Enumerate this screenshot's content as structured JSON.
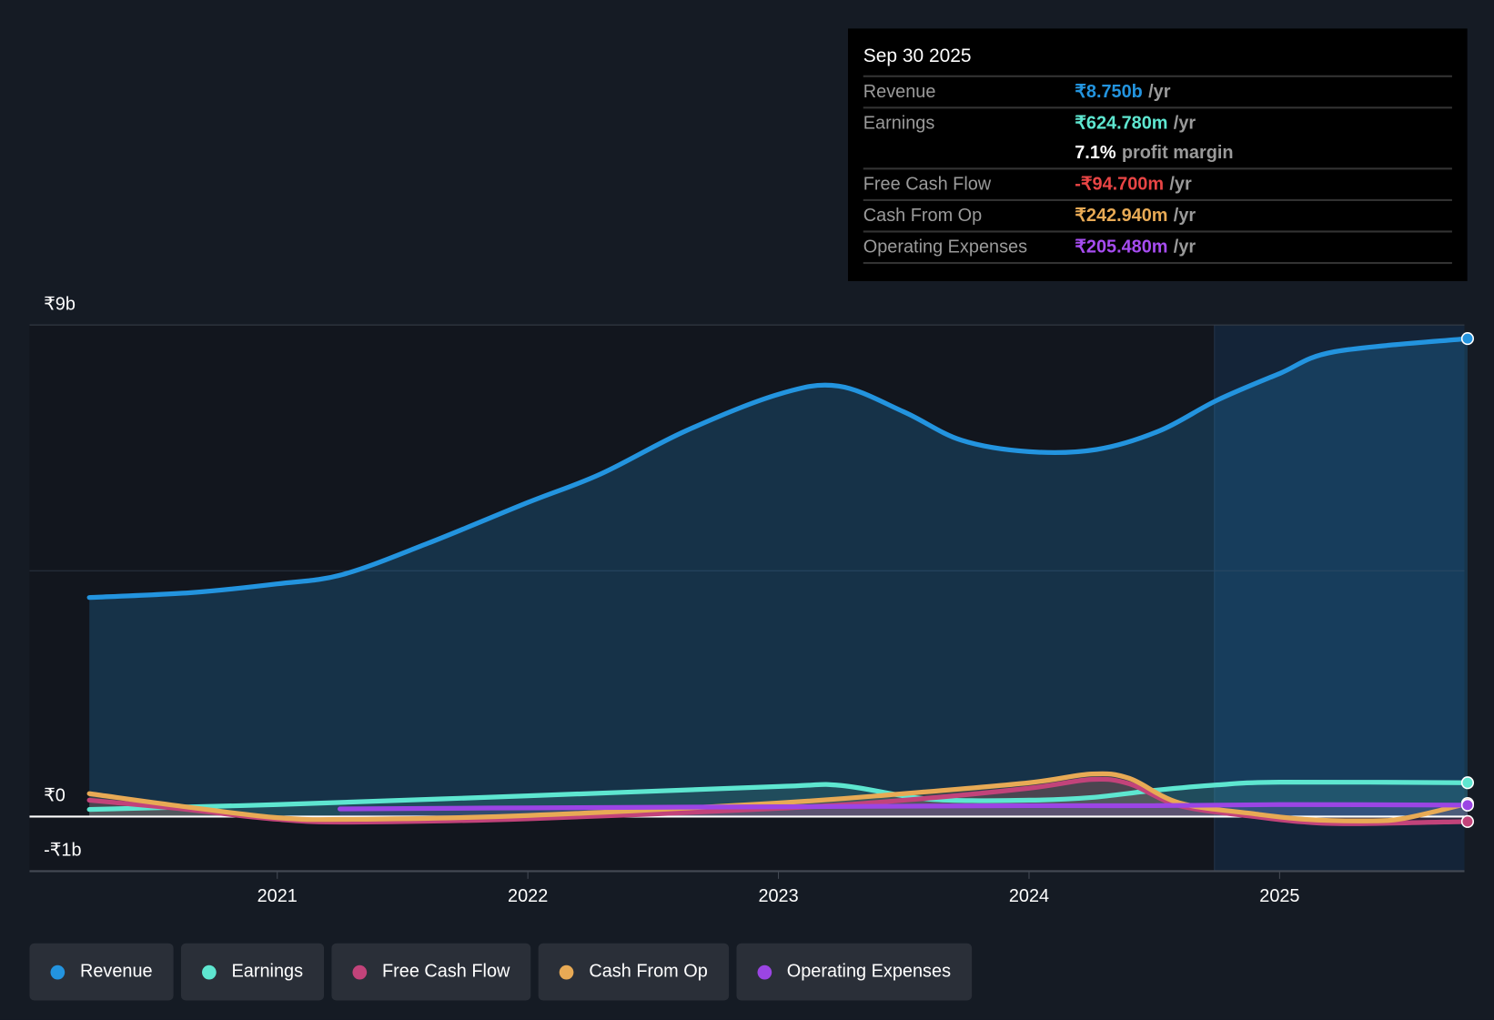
{
  "chart_data": {
    "type": "line",
    "title": "",
    "xlabel": "",
    "ylabel": "",
    "y_unit": "₹ billions",
    "ylim": [
      -1,
      9
    ],
    "xlim": [
      2020.25,
      2025.75
    ],
    "y_ticks": [
      {
        "value": 9,
        "label": "₹9b"
      },
      {
        "value": 0,
        "label": "₹0"
      },
      {
        "value": -1,
        "label": "-₹1b"
      }
    ],
    "x_ticks": [
      {
        "value": 2021,
        "label": "2021"
      },
      {
        "value": 2022,
        "label": "2022"
      },
      {
        "value": 2023,
        "label": "2023"
      },
      {
        "value": 2024,
        "label": "2024"
      },
      {
        "value": 2025,
        "label": "2025"
      }
    ],
    "highlight_from": 2024.74,
    "series": [
      {
        "name": "Revenue",
        "color": "#2394df",
        "fill": true,
        "x": [
          2020.25,
          2020.66,
          2021,
          2021.26,
          2021.6,
          2022,
          2022.29,
          2022.63,
          2023,
          2023.24,
          2023.5,
          2023.73,
          2024,
          2024.27,
          2024.52,
          2024.75,
          2025,
          2025.22,
          2025.75
        ],
        "y": [
          4.01,
          4.1,
          4.26,
          4.43,
          5.0,
          5.75,
          6.27,
          7.06,
          7.73,
          7.88,
          7.41,
          6.89,
          6.68,
          6.72,
          7.06,
          7.62,
          8.11,
          8.51,
          8.75
        ]
      },
      {
        "name": "Earnings",
        "color": "#5ee6d0",
        "x": [
          2020.25,
          2021,
          2022,
          2023,
          2023.25,
          2023.6,
          2024,
          2024.25,
          2024.5,
          2024.75,
          2025,
          2025.75
        ],
        "y": [
          0.13,
          0.22,
          0.38,
          0.55,
          0.57,
          0.32,
          0.3,
          0.35,
          0.48,
          0.58,
          0.63,
          0.62
        ]
      },
      {
        "name": "Free Cash Flow",
        "color": "#c2437a",
        "x": [
          2020.25,
          2020.6,
          2021,
          2021.3,
          2022,
          2023,
          2023.5,
          2024,
          2024.25,
          2024.4,
          2024.6,
          2024.9,
          2025.1,
          2025.3,
          2025.75
        ],
        "y": [
          0.3,
          0.15,
          -0.05,
          -0.1,
          -0.04,
          0.15,
          0.3,
          0.52,
          0.68,
          0.6,
          0.2,
          0.0,
          -0.1,
          -0.13,
          -0.09
        ]
      },
      {
        "name": "Cash From Op",
        "color": "#e8aa55",
        "x": [
          2020.25,
          2020.6,
          2021,
          2021.3,
          2022,
          2023,
          2023.5,
          2024,
          2024.25,
          2024.4,
          2024.6,
          2024.9,
          2025.1,
          2025.35,
          2025.5,
          2025.75
        ],
        "y": [
          0.42,
          0.2,
          -0.02,
          -0.05,
          0.02,
          0.25,
          0.42,
          0.62,
          0.78,
          0.7,
          0.25,
          0.05,
          -0.05,
          -0.08,
          -0.03,
          0.24
        ]
      },
      {
        "name": "Operating Expenses",
        "color": "#9b45e4",
        "x": [
          2021.25,
          2022,
          2023,
          2024,
          2024.5,
          2025,
          2025.75
        ],
        "y": [
          0.14,
          0.16,
          0.18,
          0.2,
          0.2,
          0.22,
          0.21
        ]
      }
    ]
  },
  "tooltip": {
    "date": "Sep 30 2025",
    "unit": "/yr",
    "rows": [
      {
        "label": "Revenue",
        "value": "₹8.750b",
        "color": "#2394df"
      },
      {
        "label": "Earnings",
        "value": "₹624.780m",
        "color": "#5ee6d0"
      },
      {
        "label": "Free Cash Flow",
        "value": "-₹94.700m",
        "color": "#e84545"
      },
      {
        "label": "Cash From Op",
        "value": "₹242.940m",
        "color": "#e8aa55"
      },
      {
        "label": "Operating Expenses",
        "value": "₹205.480m",
        "color": "#a64cf0"
      }
    ],
    "margin_value": "7.1%",
    "margin_label": "profit margin"
  },
  "legend": [
    {
      "label": "Revenue",
      "color": "#2394df"
    },
    {
      "label": "Earnings",
      "color": "#5ee6d0"
    },
    {
      "label": "Free Cash Flow",
      "color": "#c2437a"
    },
    {
      "label": "Cash From Op",
      "color": "#e8aa55"
    },
    {
      "label": "Operating Expenses",
      "color": "#9b45e4"
    }
  ]
}
